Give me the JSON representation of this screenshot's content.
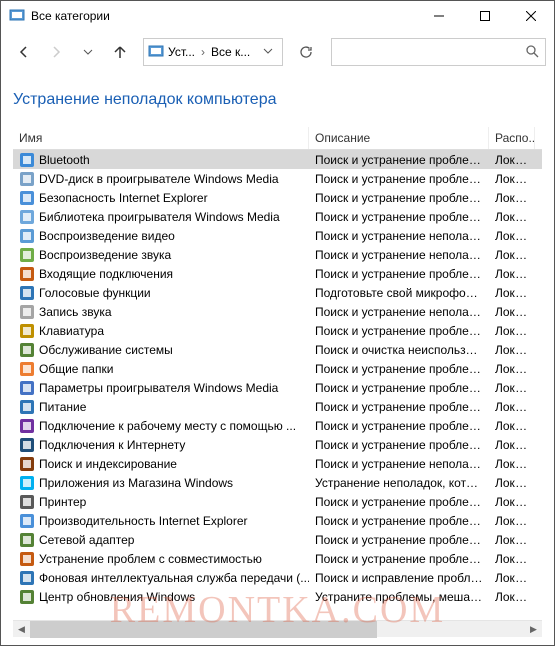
{
  "window": {
    "title": "Все категории"
  },
  "breadcrumb": {
    "part1": "Уст...",
    "part2": "Все к..."
  },
  "search": {
    "placeholder": ""
  },
  "page_header": "Устранение неполадок компьютера",
  "columns": {
    "name": "Имя",
    "desc": "Описание",
    "loc": "Распо..."
  },
  "items": [
    {
      "name": "Bluetooth",
      "desc": "Поиск и устранение проблем у...",
      "loc": "Локал...",
      "selected": true,
      "icon": "bluetooth"
    },
    {
      "name": "DVD-диск в проигрывателе Windows Media",
      "desc": "Поиск и устранение проблем с ...",
      "loc": "Локал...",
      "icon": "dvd"
    },
    {
      "name": "Безопасность Internet Explorer",
      "desc": "Поиск и устранение проблем с ...",
      "loc": "Локал...",
      "icon": "ie-security"
    },
    {
      "name": "Библиотека проигрывателя Windows Media",
      "desc": "Поиск и устранение проблем с ...",
      "loc": "Локал...",
      "icon": "wmp-library"
    },
    {
      "name": "Воспроизведение видео",
      "desc": "Поиск и устранение неполадок ...",
      "loc": "Локал...",
      "icon": "video"
    },
    {
      "name": "Воспроизведение звука",
      "desc": "Поиск и устранение неполадок ...",
      "loc": "Локал...",
      "icon": "audio"
    },
    {
      "name": "Входящие подключения",
      "desc": "Поиск и устранение проблем с ...",
      "loc": "Локал...",
      "icon": "incoming"
    },
    {
      "name": "Голосовые функции",
      "desc": "Подготовьте свой микрофон и ...",
      "loc": "Локал...",
      "icon": "voice"
    },
    {
      "name": "Запись звука",
      "desc": "Поиск и устранение неполадок ...",
      "loc": "Локал...",
      "icon": "record"
    },
    {
      "name": "Клавиатура",
      "desc": "Поиск и устранение проблем с ...",
      "loc": "Локал...",
      "icon": "keyboard"
    },
    {
      "name": "Обслуживание системы",
      "desc": "Поиск и очистка неиспользуем...",
      "loc": "Локал...",
      "icon": "maintenance"
    },
    {
      "name": "Общие папки",
      "desc": "Поиск и устранение проблем с ...",
      "loc": "Локал...",
      "icon": "shared"
    },
    {
      "name": "Параметры проигрывателя Windows Media",
      "desc": "Поиск и устранение проблем с ...",
      "loc": "Локал...",
      "icon": "wmp-settings"
    },
    {
      "name": "Питание",
      "desc": "Поиск и устранение проблем с ...",
      "loc": "Локал...",
      "icon": "power"
    },
    {
      "name": "Подключение к рабочему месту с помощью ...",
      "desc": "Поиск и устранение проблем с ...",
      "loc": "Локал...",
      "icon": "workplace"
    },
    {
      "name": "Подключения к Интернету",
      "desc": "Поиск и устранение проблем с ...",
      "loc": "Локал...",
      "icon": "internet"
    },
    {
      "name": "Поиск и индексирование",
      "desc": "Поиск и устранение неполадок ...",
      "loc": "Локал...",
      "icon": "search-index"
    },
    {
      "name": "Приложения из Магазина Windows",
      "desc": "Устранение неполадок, которы...",
      "loc": "Локал...",
      "icon": "store"
    },
    {
      "name": "Принтер",
      "desc": "Поиск и устранение проблем с ...",
      "loc": "Локал...",
      "icon": "printer"
    },
    {
      "name": "Производительность Internet Explorer",
      "desc": "Поиск и устранение проблем с ...",
      "loc": "Локал...",
      "icon": "ie-perf"
    },
    {
      "name": "Сетевой адаптер",
      "desc": "Поиск и устранение проблем с ...",
      "loc": "Локал...",
      "icon": "network"
    },
    {
      "name": "Устранение проблем с совместимостью",
      "desc": "Поиск и устранение проблем с ...",
      "loc": "Локал...",
      "icon": "compat"
    },
    {
      "name": "Фоновая интеллектуальная служба передачи (...",
      "desc": "Поиск и исправление проблем, ...",
      "loc": "Локал...",
      "icon": "bits"
    },
    {
      "name": "Центр обновления Windows",
      "desc": "Устраните проблемы, мешающ...",
      "loc": "Локал...",
      "icon": "update"
    }
  ],
  "watermark": "REMONTKA.COM"
}
